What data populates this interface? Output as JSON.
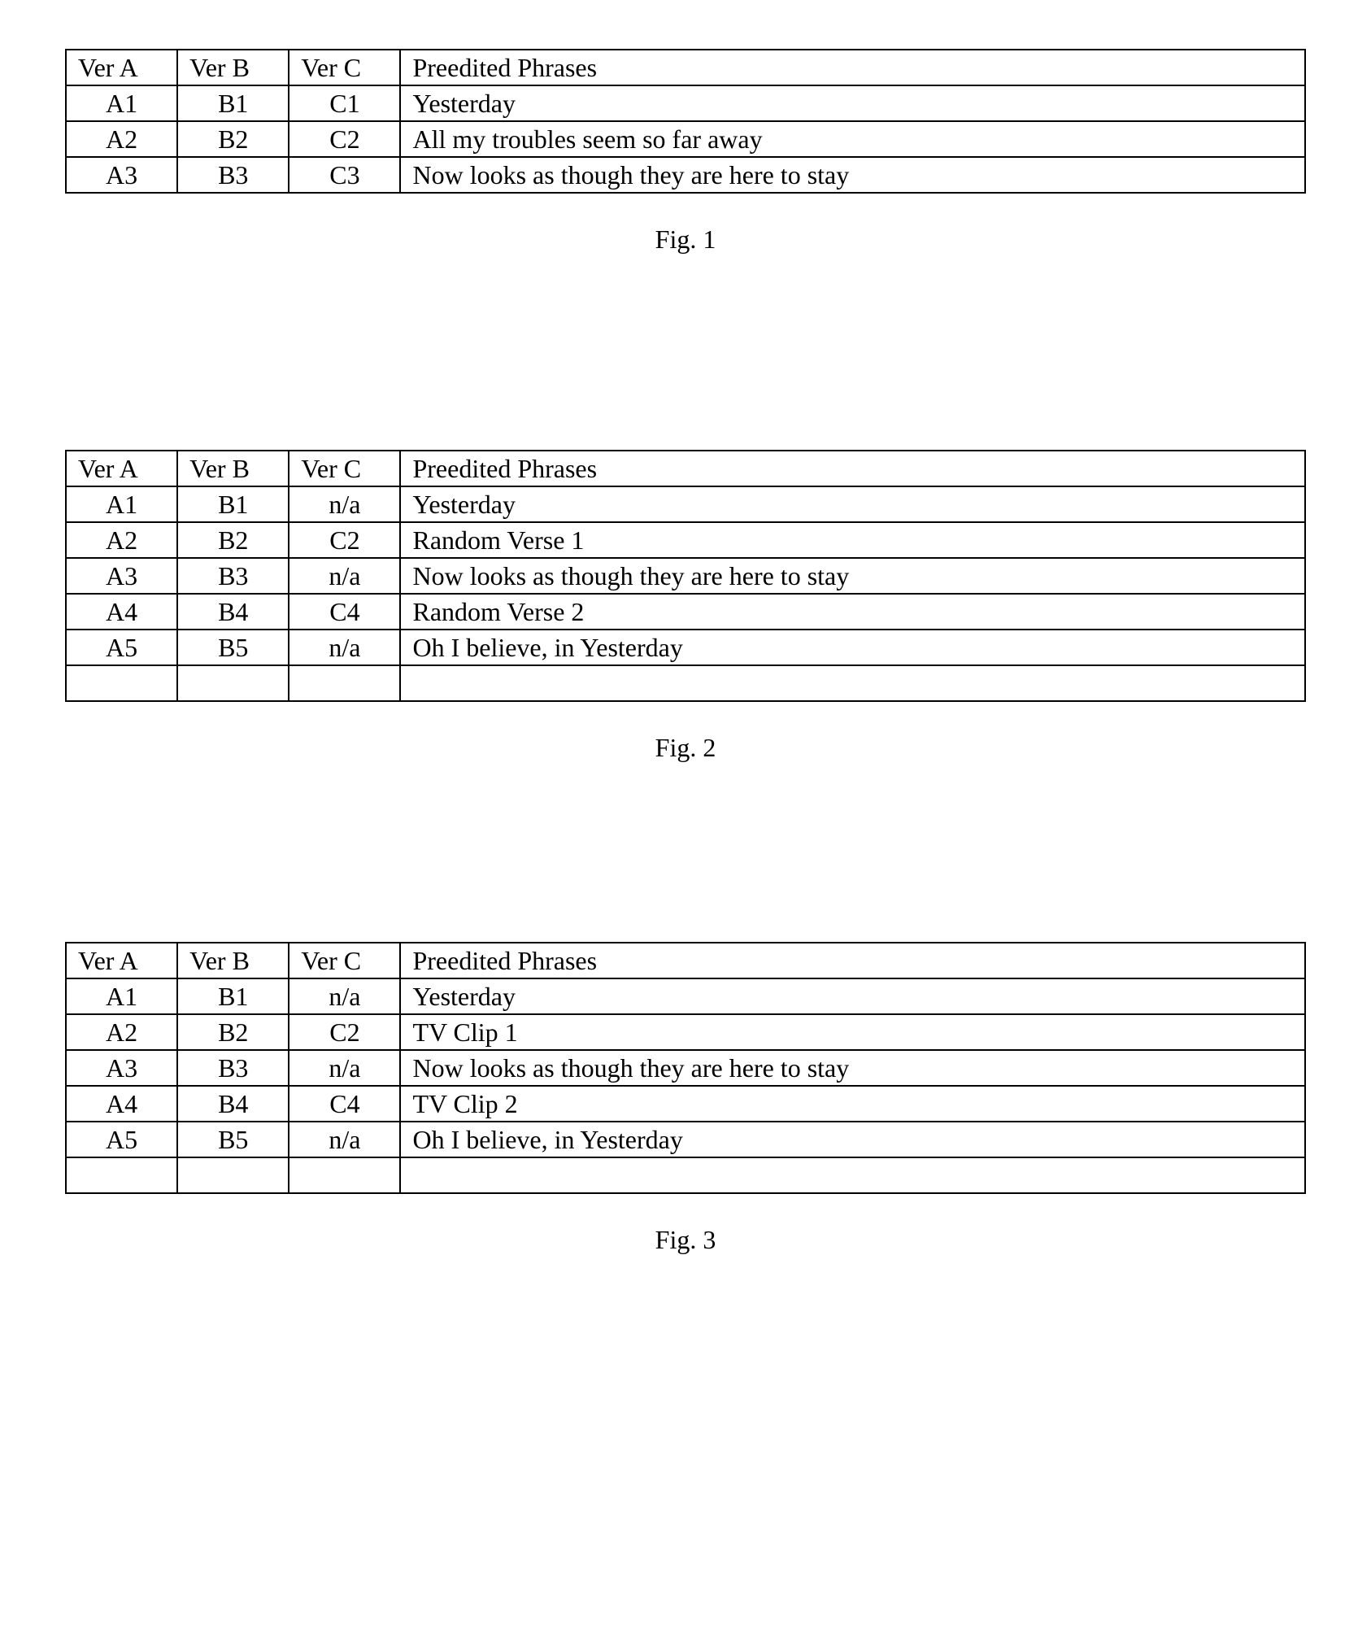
{
  "tables": [
    {
      "caption": "Fig. 1",
      "headers": {
        "a": "Ver A",
        "b": "Ver B",
        "c": "Ver C",
        "d": "Preedited Phrases"
      },
      "rows": [
        {
          "a": "A1",
          "b": "B1",
          "c": "C1",
          "d": "Yesterday"
        },
        {
          "a": "A2",
          "b": "B2",
          "c": "C2",
          "d": "All my troubles seem so far away"
        },
        {
          "a": "A3",
          "b": "B3",
          "c": "C3",
          "d": "Now looks as though they are here to stay"
        }
      ],
      "empty_trailing_row": false
    },
    {
      "caption": "Fig. 2",
      "headers": {
        "a": "Ver A",
        "b": "Ver B",
        "c": "Ver C",
        "d": "Preedited Phrases"
      },
      "rows": [
        {
          "a": "A1",
          "b": "B1",
          "c": "n/a",
          "d": "Yesterday"
        },
        {
          "a": "A2",
          "b": "B2",
          "c": "C2",
          "d": "Random Verse 1"
        },
        {
          "a": "A3",
          "b": "B3",
          "c": "n/a",
          "d": "Now looks as though they are here to stay"
        },
        {
          "a": "A4",
          "b": "B4",
          "c": "C4",
          "d": "Random Verse 2"
        },
        {
          "a": "A5",
          "b": "B5",
          "c": "n/a",
          "d": "Oh I believe, in Yesterday"
        }
      ],
      "empty_trailing_row": true
    },
    {
      "caption": "Fig. 3",
      "headers": {
        "a": "Ver A",
        "b": "Ver B",
        "c": "Ver C",
        "d": "Preedited Phrases"
      },
      "rows": [
        {
          "a": "A1",
          "b": "B1",
          "c": "n/a",
          "d": "Yesterday"
        },
        {
          "a": "A2",
          "b": "B2",
          "c": "C2",
          "d": "TV Clip 1"
        },
        {
          "a": "A3",
          "b": "B3",
          "c": "n/a",
          "d": "Now looks as though they are here to stay"
        },
        {
          "a": "A4",
          "b": "B4",
          "c": "C4",
          "d": "TV Clip 2"
        },
        {
          "a": "A5",
          "b": "B5",
          "c": "n/a",
          "d": "Oh I believe, in Yesterday"
        }
      ],
      "empty_trailing_row": true
    }
  ]
}
